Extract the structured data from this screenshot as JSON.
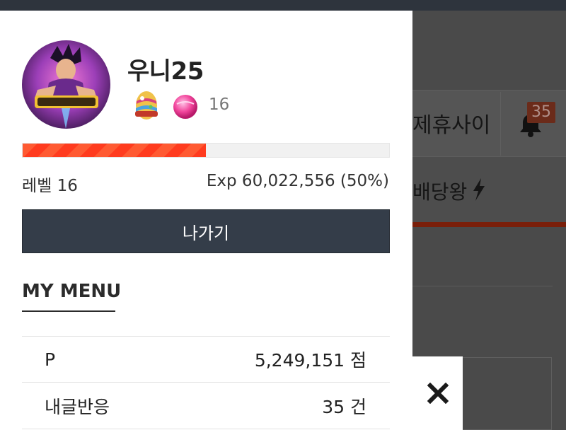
{
  "background": {
    "nav_partner_label": "제휴사이",
    "notification_count": "35",
    "dividend_label": "배당왕"
  },
  "profile": {
    "username": "우니25",
    "badge_count": "16",
    "level_text": "레벨 16",
    "exp_text": "Exp 60,022,556 (50%)",
    "exp_progress": 0.5
  },
  "actions": {
    "logout_label": "나가기"
  },
  "menu": {
    "title": "MY MENU",
    "rows": [
      {
        "label": "P",
        "value": "5,249,151 점"
      },
      {
        "label": "내글반응",
        "value": "35 건"
      }
    ]
  },
  "colors": {
    "progress_fill": "#ff3b1e",
    "logout_button": "#343d49",
    "topbar": "#2e343d",
    "overlay": "#4a4a4a"
  },
  "icons": [
    "bell-icon",
    "bolt-icon",
    "close-icon",
    "egg-badge-icon",
    "pink-gem-icon",
    "avatar"
  ]
}
